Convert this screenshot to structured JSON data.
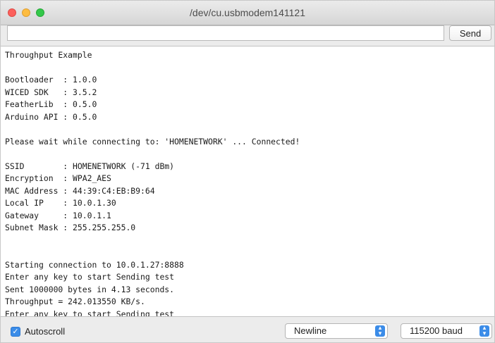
{
  "window": {
    "title": "/dev/cu.usbmodem141121"
  },
  "toolbar": {
    "input_value": "",
    "input_placeholder": "",
    "send_label": "Send"
  },
  "output": {
    "lines": [
      "Throughput Example",
      "",
      "Bootloader  : 1.0.0",
      "WICED SDK   : 3.5.2",
      "FeatherLib  : 0.5.0",
      "Arduino API : 0.5.0",
      "",
      "Please wait while connecting to: 'HOMENETWORK' ... Connected!",
      "",
      "SSID        : HOMENETWORK (-71 dBm)",
      "Encryption  : WPA2_AES",
      "MAC Address : 44:39:C4:EB:B9:64",
      "Local IP    : 10.0.1.30",
      "Gateway     : 10.0.1.1",
      "Subnet Mask : 255.255.255.0",
      "",
      "",
      "Starting connection to 10.0.1.27:8888",
      "Enter any key to start Sending test",
      "Sent 1000000 bytes in 4.13 seconds.",
      "Throughput = 242.013550 KB/s.",
      "Enter any key to start Sending test"
    ]
  },
  "statusbar": {
    "autoscroll_label": "Autoscroll",
    "autoscroll_checked": true,
    "line_ending": "Newline",
    "baud_rate": "115200 baud"
  },
  "icons": {
    "check": "checkmark-icon",
    "stepper": "up-down-chevron-icon"
  },
  "colors": {
    "accent": "#3b8ce8",
    "close": "#fc605c",
    "minimize": "#fdbc40",
    "zoom": "#34c84a"
  }
}
